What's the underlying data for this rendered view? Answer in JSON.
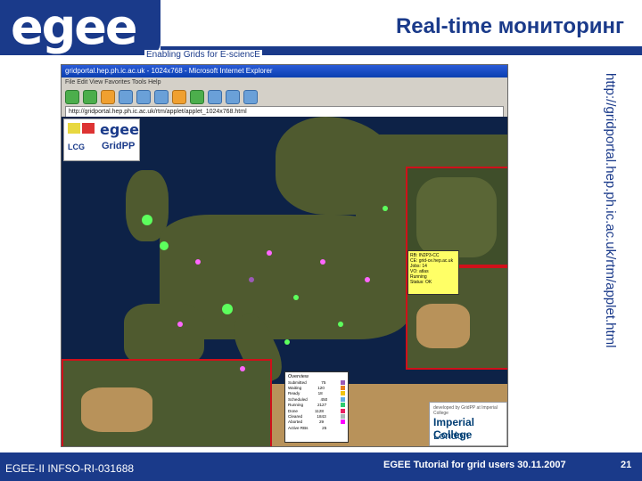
{
  "slide": {
    "logo": "egee",
    "tagline": "Enabling Grids for E-sciencE",
    "title": "Real-time мониторинг",
    "url": "http://gridportal.hep.ph.ic.ac.uk/rtm/applet.html",
    "footer_left": "EGEE-II INFSO-RI-031688",
    "footer_right": "EGEE Tutorial for grid users   30.11.2007",
    "page_number": "21"
  },
  "browser": {
    "window_title": "gridportal.hep.ph.ic.ac.uk - 1024x768 - Microsoft Internet Explorer",
    "menu": "File  Edit  View  Favorites  Tools  Help",
    "address": "http://gridportal.hep.ph.ic.ac.uk/rtm/applet/applet_1024x768.html",
    "toolbar_icons": [
      "back-icon",
      "forward-icon",
      "stop-icon",
      "refresh-icon",
      "home-icon",
      "search-icon",
      "favorites-icon",
      "media-icon",
      "history-icon",
      "mail-icon",
      "print-icon"
    ]
  },
  "map": {
    "logos": {
      "lcg": "LCG",
      "egee": "egee",
      "gridpp": "GridPP"
    },
    "popup_lines": [
      "RB: IN2P3-CC",
      "CE: grid-ce.hep.ac.uk",
      "Jobs: 14",
      "VO: atlas",
      "Running",
      "Status: OK"
    ],
    "legend": {
      "title": "Overview",
      "rows": [
        {
          "label": "Submitted",
          "value": "75",
          "color": "#9b59b6"
        },
        {
          "label": "Waiting",
          "value": "120",
          "color": "#e67e22"
        },
        {
          "label": "Ready",
          "value": "18",
          "color": "#f1c40f"
        },
        {
          "label": "Scheduled",
          "value": "450",
          "color": "#5dade2"
        },
        {
          "label": "Running",
          "value": "2127",
          "color": "#2ecc71"
        },
        {
          "label": "Done",
          "value": "1128",
          "color": "#e91e63"
        },
        {
          "label": "Cleared",
          "value": "1843",
          "color": "#aab7b8"
        },
        {
          "label": "Aborted",
          "value": "29",
          "color": "#ff00ff"
        },
        {
          "label": "Active RBs",
          "value": "25",
          "color": "#ffffff"
        }
      ]
    },
    "credit": "developed by GridPP at Imperial College",
    "imperial_name": "Imperial College",
    "imperial_city": "London"
  },
  "colors": {
    "brand": "#1a3a8a",
    "highlight": "#d0101a"
  }
}
